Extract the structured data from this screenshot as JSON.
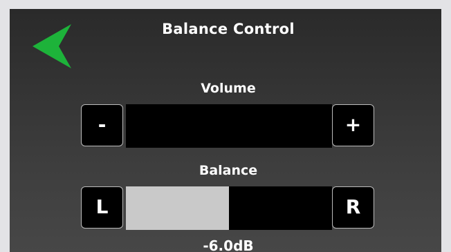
{
  "header": {
    "title": "Balance Control",
    "back_icon": "back-arrow-icon",
    "accent_color": "#1db33a"
  },
  "volume": {
    "label": "Volume",
    "decrease_label": "-",
    "increase_label": "+",
    "level_fraction": 0.0
  },
  "balance": {
    "label": "Balance",
    "left_label": "L",
    "right_label": "R",
    "position_fraction": 0.5,
    "readout": "-6.0dB"
  }
}
